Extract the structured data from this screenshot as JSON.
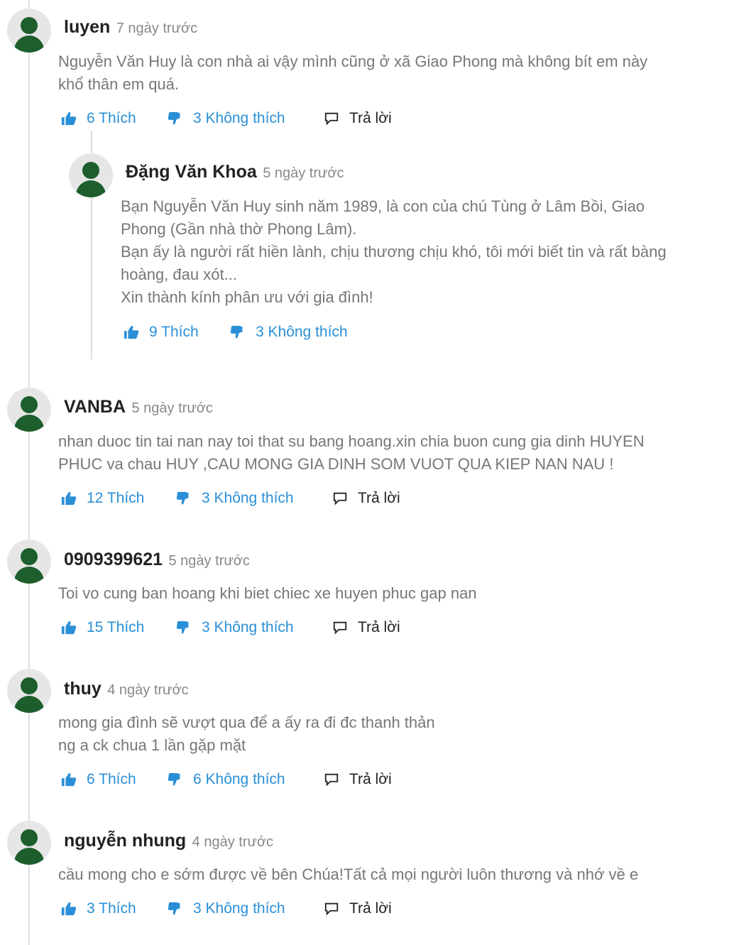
{
  "comments": [
    {
      "author": "luyen",
      "time": "7 ngày trước",
      "text": "Nguyễn Văn Huy là con nhà ai vậy mình cũng ở xã Giao Phong mà không bít em này\nkhổ thân em quá.",
      "likes": "6 Thích",
      "dislikes": "3 Không thích",
      "reply": "Trả lời"
    },
    {
      "author": "Đặng Văn Khoa",
      "time": "5 ngày trước",
      "text": "Bạn Nguyễn Văn Huy sinh năm 1989, là con của chú Tùng ở Lâm Bồi, Giao\nPhong (Gần nhà thờ Phong Lâm).\nBạn ấy là người rất hiền lành, chịu thương chịu khó, tôi mới biết tin và rất bàng\nhoàng, đau xót...\nXin thành kính phân ưu với gia đình!",
      "likes": "9 Thích",
      "dislikes": "3 Không thích"
    },
    {
      "author": "VANBA",
      "time": "5 ngày trước",
      "text": "nhan duoc tin tai nan nay toi that su bang hoang.xin chia buon cung gia dinh HUYEN\nPHUC va chau HUY ,CAU MONG GIA DINH SOM VUOT QUA KIEP NAN NAU !",
      "likes": "12 Thích",
      "dislikes": "3 Không thích",
      "reply": "Trả lời"
    },
    {
      "author": "0909399621",
      "time": "5 ngày trước",
      "text": "Toi vo cung ban hoang khi biet chiec xe huyen phuc gap nan",
      "likes": "15 Thích",
      "dislikes": "3 Không thích",
      "reply": "Trả lời"
    },
    {
      "author": "thuy",
      "time": "4 ngày trước",
      "text": "mong gia đình sẽ vượt qua để a ấy ra đi đc thanh thản\nng a ck chua 1 lần gặp mặt",
      "likes": "6 Thích",
      "dislikes": "6 Không thích",
      "reply": "Trả lời"
    },
    {
      "author": "nguyễn nhung",
      "time": "4 ngày trước",
      "text": "cầu mong cho e sớm được về bên Chúa!Tất cả mọi người luôn thương và nhớ về e",
      "likes": "3 Thích",
      "dislikes": "3 Không thích",
      "reply": "Trả lời"
    }
  ],
  "icons": {
    "like": "thumbs-up-icon",
    "dislike": "thumbs-down-icon",
    "reply": "speech-bubble-icon",
    "avatar": "user-silhouette-icon"
  },
  "colors": {
    "accent": "#2a8fd6",
    "avatar": "#1d5e2c",
    "text": "#777777",
    "author": "#222222"
  }
}
